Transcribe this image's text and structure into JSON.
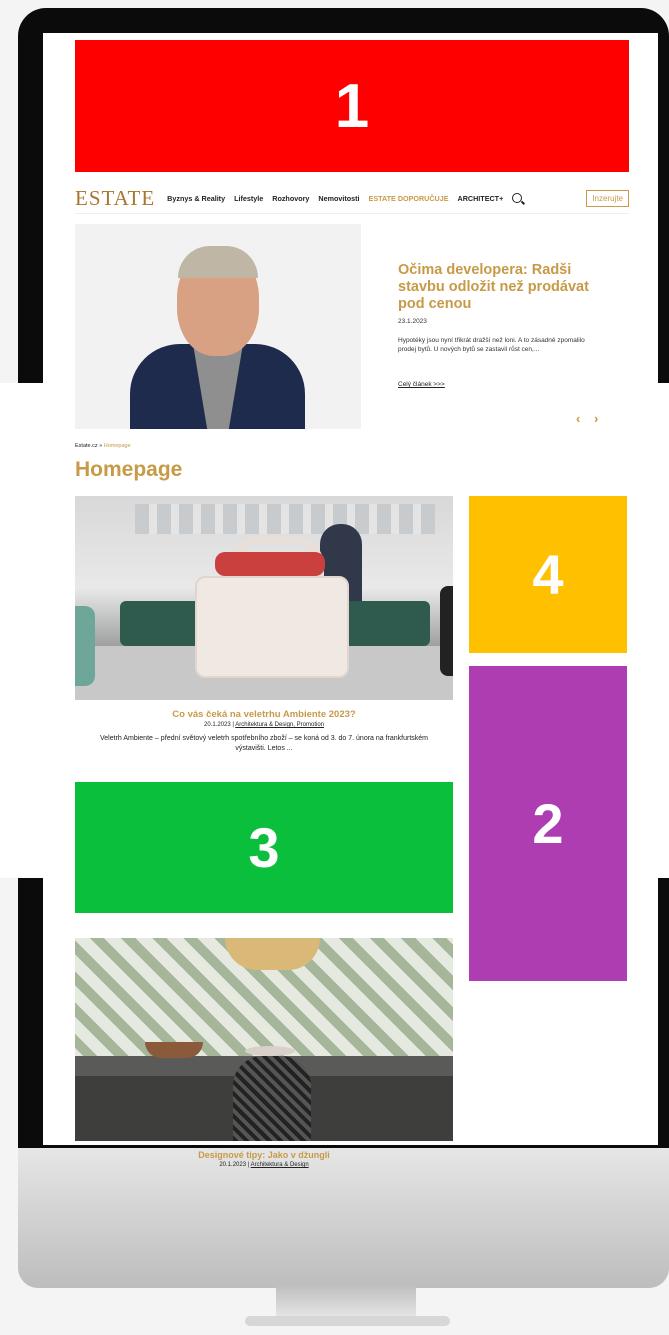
{
  "ad_slots": {
    "slot1": "1",
    "slot2": "2",
    "slot3": "3",
    "slot4": "4"
  },
  "header": {
    "logo": "ESTATE",
    "nav": [
      "Byznys & Reality",
      "Lifestyle",
      "Rozhovory",
      "Nemovitosti",
      "ESTATE DOPORUČUJE",
      "ARCHITECT+"
    ],
    "search_icon": "search-icon",
    "advertise_label": "Inzerujte"
  },
  "hero": {
    "title": "Očima developera: Radši stavbu odložit než prodávat pod cenou",
    "date": "23.1.2023",
    "excerpt": "Hypotéky jsou nyní třikrát dražší než loni. A to zásadně zpomalilo prodej bytů. U nových bytů se zastavil růst cen,...",
    "more": "Celý článek >>>",
    "arrows": "‹ ›"
  },
  "breadcrumb": {
    "root": "Estate.cz",
    "sep": "»",
    "current": "Homepage"
  },
  "page_title": "Homepage",
  "articles": [
    {
      "title": "Co vás čeká na veletrhu Ambiente 2023?",
      "date": "20.1.2023",
      "sep": "|",
      "categories": "Architektura & Design, Promotion",
      "excerpt": "Veletrh Ambiente – přední světový veletrh spotřebního zboží – se koná od 3. do 7. února na frankfurtském výstavišti. Letos ..."
    },
    {
      "title": "Designové tipy: Jako v džungli",
      "date": "20.1.2023",
      "sep": "|",
      "categories": "Architektura & Design"
    }
  ]
}
